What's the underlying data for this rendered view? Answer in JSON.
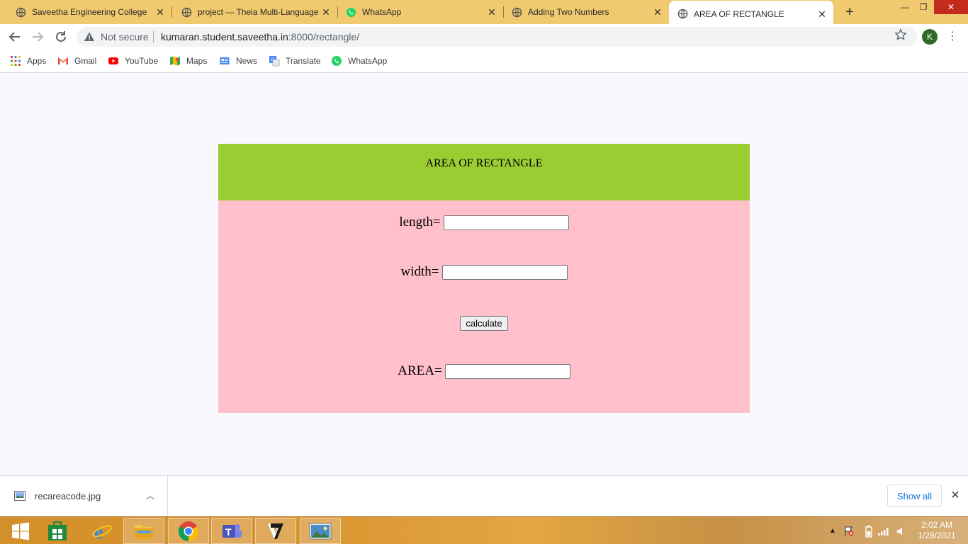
{
  "browser": {
    "tabs": [
      {
        "title": "Saveetha Engineering College",
        "icon": "globe-icon",
        "active": false
      },
      {
        "title": "project — Theia Multi-Language",
        "icon": "globe-icon",
        "active": false
      },
      {
        "title": "WhatsApp",
        "icon": "whatsapp-icon",
        "active": false
      },
      {
        "title": "Adding Two Numbers",
        "icon": "globe-icon",
        "active": false
      },
      {
        "title": "AREA OF RECTANGLE",
        "icon": "globe-icon",
        "active": true
      }
    ],
    "new_tab_label": "+",
    "security_label": "Not secure",
    "url_host": "kumaran.student.saveetha.in",
    "url_path": ":8000/rectangle/",
    "profile_initial": "K",
    "bookmarks": [
      {
        "label": "Apps",
        "icon": "apps-grid-icon"
      },
      {
        "label": "Gmail",
        "icon": "gmail-icon"
      },
      {
        "label": "YouTube",
        "icon": "youtube-icon"
      },
      {
        "label": "Maps",
        "icon": "maps-icon"
      },
      {
        "label": "News",
        "icon": "news-icon"
      },
      {
        "label": "Translate",
        "icon": "translate-icon"
      },
      {
        "label": "WhatsApp",
        "icon": "whatsapp-icon"
      }
    ]
  },
  "page": {
    "heading": "AREA OF RECTANGLE",
    "length_label": "length=",
    "length_value": "",
    "width_label": "width=",
    "width_value": "",
    "calculate_label": "calculate",
    "area_label": "AREA=",
    "area_value": "",
    "header_color": "#9acd32",
    "form_color": "#ffc0cb"
  },
  "download_shelf": {
    "file_name": "recareacode.jpg",
    "show_all_label": "Show all"
  },
  "taskbar": {
    "apps": [
      "start-icon",
      "store-icon",
      "ie-icon",
      "file-explorer-icon",
      "chrome-icon",
      "teams-icon",
      "vegas-icon",
      "photos-icon"
    ],
    "time": "2:02 AM",
    "date": "1/28/2021"
  }
}
